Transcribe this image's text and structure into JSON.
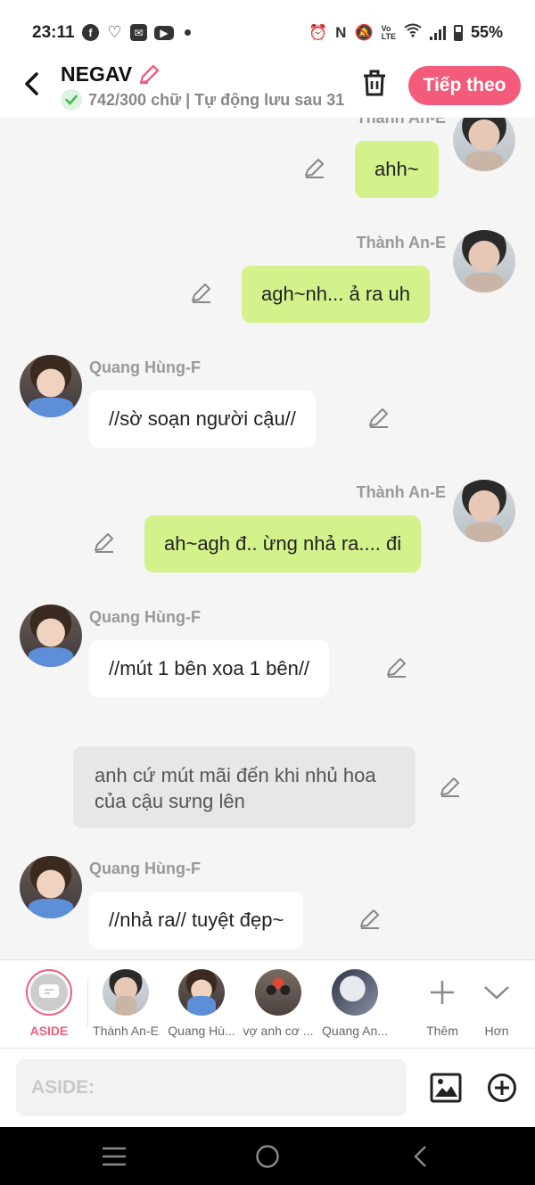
{
  "status_bar": {
    "time": "23:11",
    "battery": "55%",
    "left_icons": [
      "facebook-icon",
      "heart-icon",
      "mail-icon",
      "youtube-icon"
    ],
    "right_icons": [
      "alarm-icon",
      "nfc-icon",
      "mute-icon",
      "volte-icon",
      "wifi-icon",
      "signal-icon",
      "battery-icon"
    ]
  },
  "header": {
    "title": "NEGAV",
    "subtitle": "742/300 chữ | Tự động lưu sau 31",
    "next_label": "Tiếp theo"
  },
  "messages": [
    {
      "side": "right",
      "speaker": "Thành An-E",
      "text": "ahh~",
      "style": "green"
    },
    {
      "side": "right",
      "speaker": "Thành An-E",
      "text": "agh~nh... ả ra uh",
      "style": "green"
    },
    {
      "side": "left",
      "speaker": "Quang Hùng-F",
      "text": "//sờ soạn người cậu//",
      "style": "white"
    },
    {
      "side": "right",
      "speaker": "Thành An-E",
      "text": "ah~agh đ.. ừng nhả ra.... đi",
      "style": "green"
    },
    {
      "side": "left",
      "speaker": "Quang Hùng-F",
      "text": "//mút 1 bên xoa 1 bên//",
      "style": "white"
    },
    {
      "side": "narration",
      "text": "anh cứ mút mãi đến khi nhủ hoa của cậu sưng lên"
    },
    {
      "side": "left",
      "speaker": "Quang Hùng-F",
      "text": "//nhả ra// tuyệt đẹp~",
      "style": "white"
    }
  ],
  "characters": [
    {
      "label": "ASIDE",
      "active": true
    },
    {
      "label": "Thành An-E"
    },
    {
      "label": "Quang Hù..."
    },
    {
      "label": "vợ anh cơ ..."
    },
    {
      "label": "Quang An..."
    }
  ],
  "actions": {
    "more_label": "Thêm",
    "expand_label": "Hơn"
  },
  "input": {
    "placeholder": "ASIDE:"
  },
  "colors": {
    "accent": "#f25c7a",
    "bubble_green": "#d4f28c",
    "bubble_white": "#ffffff",
    "narration": "#e7e7e7"
  }
}
